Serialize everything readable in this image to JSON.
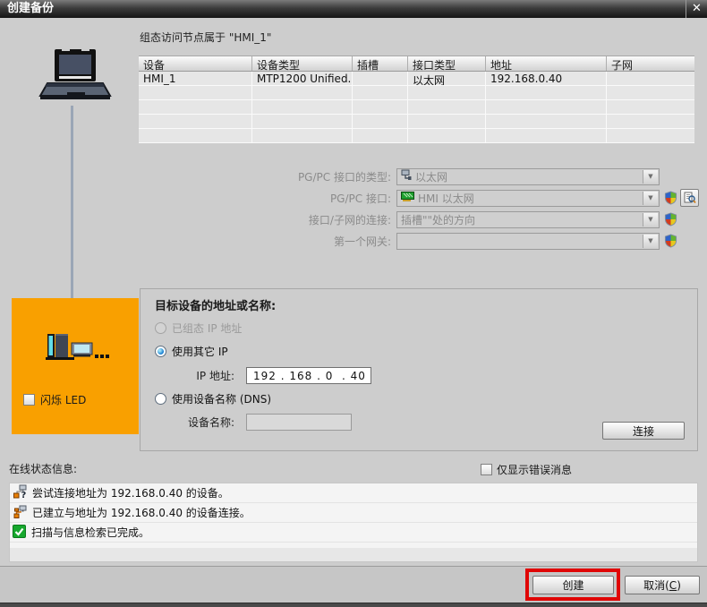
{
  "window": {
    "title": "创建备份",
    "close_glyph": "✕"
  },
  "icons": {
    "dropdown_arrow": "▼"
  },
  "access_nodes": {
    "caption": "组态访问节点属于 \"HMI_1\"",
    "columns": [
      "设备",
      "设备类型",
      "插槽",
      "接口类型",
      "地址",
      "子网"
    ],
    "row": {
      "device": "HMI_1",
      "device_type": "MTP1200 Unified...",
      "slot": "",
      "interface_type": "以太网",
      "address": "192.168.0.40",
      "subnet": ""
    }
  },
  "pgpc_form": {
    "type_label": "PG/PC 接口的类型:",
    "type_value": "以太网",
    "interface_label": "PG/PC 接口:",
    "interface_value": "HMI 以太网",
    "connection_label": "接口/子网的连接:",
    "connection_value": "插槽\"\"处的方向",
    "gateway_label": "第一个网关:",
    "gateway_value": ""
  },
  "target": {
    "title": "目标设备的地址或名称:",
    "configured_ip_label": "已组态 IP 地址",
    "other_ip_label": "使用其它 IP",
    "ip_label": "IP 地址:",
    "ip_value": "192 . 168 . 0  . 40",
    "dns_label": "使用设备名称 (DNS)",
    "device_name_label": "设备名称:",
    "device_name_value": "",
    "connect_button": "连接"
  },
  "device_panel": {
    "flash_led_label": "闪烁 LED"
  },
  "online_status": {
    "label": "在线状态信息:",
    "errors_only_label": "仅显示错误消息",
    "messages": [
      {
        "icon": "connect-attempt-icon",
        "text": "尝试连接地址为 192.168.0.40 的设备。"
      },
      {
        "icon": "connection-established-icon",
        "text": "已建立与地址为 192.168.0.40 的设备连接。"
      },
      {
        "icon": "scan-complete-icon",
        "text": "扫描与信息检索已完成。"
      }
    ]
  },
  "footer": {
    "create_button": "创建",
    "cancel_prefix": "取消(",
    "cancel_key": "C",
    "cancel_suffix": ")"
  },
  "colors": {
    "accent_orange": "#F9A000",
    "highlight_red": "#E00505",
    "success_green": "#17A82E",
    "titlebar_dark": "#141414"
  }
}
